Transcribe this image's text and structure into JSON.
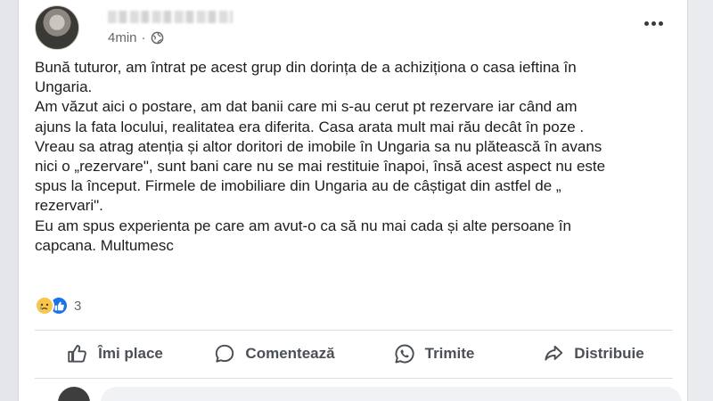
{
  "post": {
    "time": "4min",
    "separator": "·",
    "paragraph_lines": [
      "Bună tuturor, am întrat pe acest grup din dorința de a achiziționa o casa ieftina în",
      "Ungaria.",
      "Am văzut aici o postare, am dat banii care mi s-au cerut pt rezervare iar când am",
      "ajuns la fata locului, realitatea era diferita. Casa arata mult mai rău decât în poze .",
      "Vreau sa atrag atenția și altor doritori de imobile în Ungaria sa nu plătească în avans",
      "nici o „rezervare\", sunt bani care nu se mai restituie înapoi, însă acest aspect nu este",
      "spus la început. Firmele de imobiliare  din Ungaria au de câștigat din astfel de „",
      "rezervari\".",
      "Eu am spus experienta pe care am avut-o ca să nu mai cada și alte persoane în",
      "capcana. Multumesc"
    ]
  },
  "reactions": {
    "icons": [
      "sad-reaction-icon",
      "like-reaction-icon"
    ],
    "count": "3"
  },
  "actions": {
    "like": "Îmi place",
    "comment": "Comentează",
    "send": "Trimite",
    "share": "Distribuie"
  },
  "colors": {
    "text": "#1c1e21",
    "secondary": "#65676b",
    "action": "#4b4f56",
    "like_blue": "#1a73e8",
    "sad_yellow": "#f7c64a"
  }
}
